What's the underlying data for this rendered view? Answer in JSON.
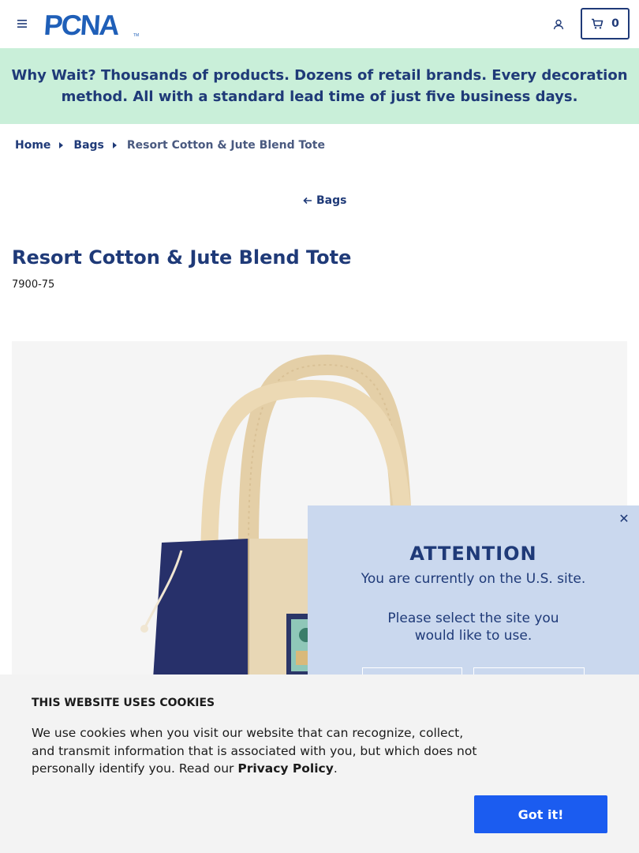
{
  "header": {
    "logo_text": "PCNA",
    "cart_count": "0"
  },
  "banner": {
    "text": "Why Wait? Thousands of products. Dozens of retail brands. Every decoration method. All with a standard lead time of just five business days."
  },
  "breadcrumb": {
    "items": [
      "Home",
      "Bags"
    ],
    "current": "Resort Cotton & Jute Blend Tote"
  },
  "back_link": {
    "label": "Bags"
  },
  "product": {
    "title": "Resort Cotton & Jute Blend Tote",
    "sku": "7900-75"
  },
  "modal": {
    "heading": "ATTENTION",
    "line1": "You are currently on the U.S. site.",
    "line2": "Please select the site you would like to use."
  },
  "cookie": {
    "title": "THIS WEBSITE USES COOKIES",
    "text_before": "We use cookies when you visit our website that can recognize, collect, and transmit information that is associated with you, but which does not personally identify you. Read our ",
    "link": "Privacy Policy",
    "text_after": ".",
    "button": "Got it!"
  },
  "colors": {
    "brand_navy": "#1f3a78",
    "banner_bg": "#c9efd9",
    "modal_bg": "#cad8ee",
    "button_blue": "#1b5cf0"
  }
}
